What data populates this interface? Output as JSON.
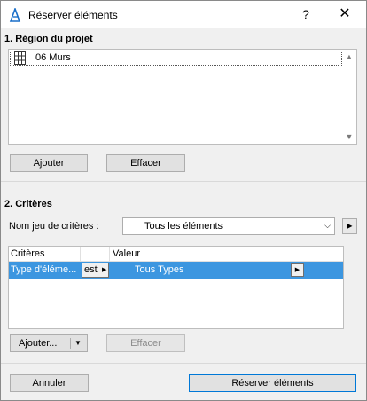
{
  "window": {
    "title": "Réserver éléments",
    "help": "?",
    "close": "✕"
  },
  "region": {
    "title": "1. Région du projet",
    "items": [
      {
        "label": "06 Murs",
        "icon": "wall-grid-icon"
      }
    ],
    "add_label": "Ajouter",
    "clear_label": "Effacer"
  },
  "criteria": {
    "title": "2. Critères",
    "set_label": "Nom jeu de critères :",
    "set_value": "Tous les éléments",
    "columns": {
      "criteria": "Critères",
      "operator": "",
      "value": "Valeur"
    },
    "rows": [
      {
        "criteria": "Type d'éléme...",
        "operator": "est",
        "value": "Tous Types"
      }
    ],
    "add_label": "Ajouter...",
    "clear_label": "Effacer"
  },
  "footer": {
    "cancel_label": "Annuler",
    "reserve_label": "Réserver éléments"
  },
  "colors": {
    "selection": "#3c96e0",
    "primary_border": "#0078d7"
  }
}
